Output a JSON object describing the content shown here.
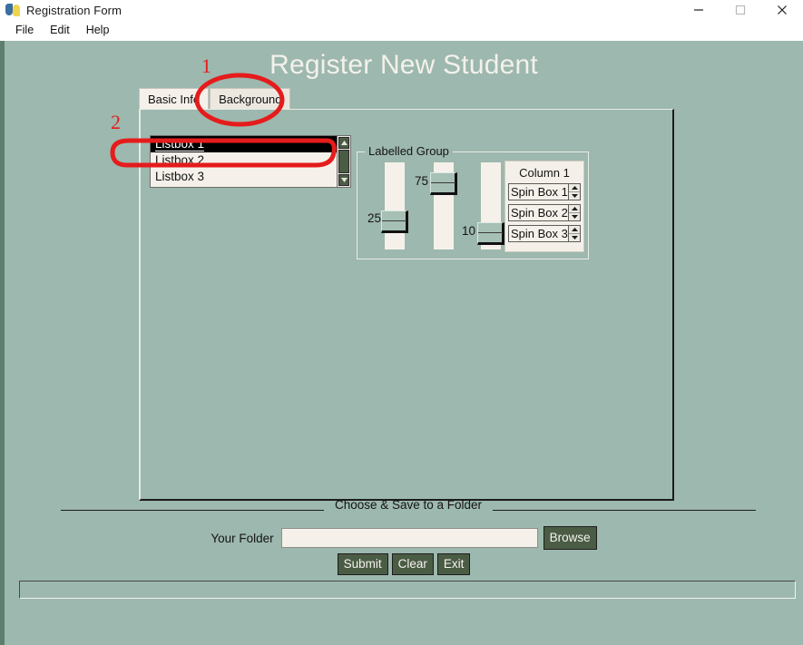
{
  "window": {
    "title": "Registration Form",
    "icon": "python-logo-icon",
    "controls": {
      "minimize": "minimize-icon",
      "maximize": "maximize-icon",
      "close": "close-icon"
    }
  },
  "menu": {
    "items": [
      {
        "label": "File"
      },
      {
        "label": "Edit"
      },
      {
        "label": "Help"
      }
    ]
  },
  "header": {
    "title": "Register New Student"
  },
  "tabs": [
    {
      "label": "Basic Info",
      "active": false
    },
    {
      "label": "Background",
      "active": true
    }
  ],
  "listbox": {
    "items": [
      {
        "label": "Listbox 1",
        "selected": true
      },
      {
        "label": "Listbox 2",
        "selected": false
      },
      {
        "label": "Listbox 3",
        "selected": false
      }
    ],
    "scrollbar": {
      "up": "scroll-up-arrow-icon",
      "down": "scroll-down-arrow-icon"
    }
  },
  "labelled_group": {
    "legend": "Labelled Group",
    "sliders": [
      {
        "value": "25",
        "percent": 25
      },
      {
        "value": "75",
        "percent": 75
      },
      {
        "value": "10",
        "percent": 10
      }
    ],
    "column": {
      "header": "Column 1",
      "spinboxes": [
        {
          "value": "Spin Box 1"
        },
        {
          "value": "Spin Box 2"
        },
        {
          "value": "Spin Box 3"
        }
      ]
    }
  },
  "folder_section": {
    "separator_label": "Choose & Save to a Folder",
    "field_label": "Your Folder",
    "field_value": "",
    "field_placeholder": "",
    "browse_label": "Browse"
  },
  "actions": [
    {
      "label": "Submit"
    },
    {
      "label": "Clear"
    },
    {
      "label": "Exit"
    }
  ],
  "status_bar": {
    "text": ""
  },
  "annotations": [
    {
      "number": "1",
      "target": "Background tab"
    },
    {
      "number": "2",
      "target": "Listbox 1 selected row"
    }
  ],
  "colors": {
    "window_background": "#9db8ae",
    "title_text": "#f3f1eb",
    "button_fill": "#4b5c45",
    "field_fill": "#f5f1ea",
    "annotation": "#e51c1c"
  }
}
